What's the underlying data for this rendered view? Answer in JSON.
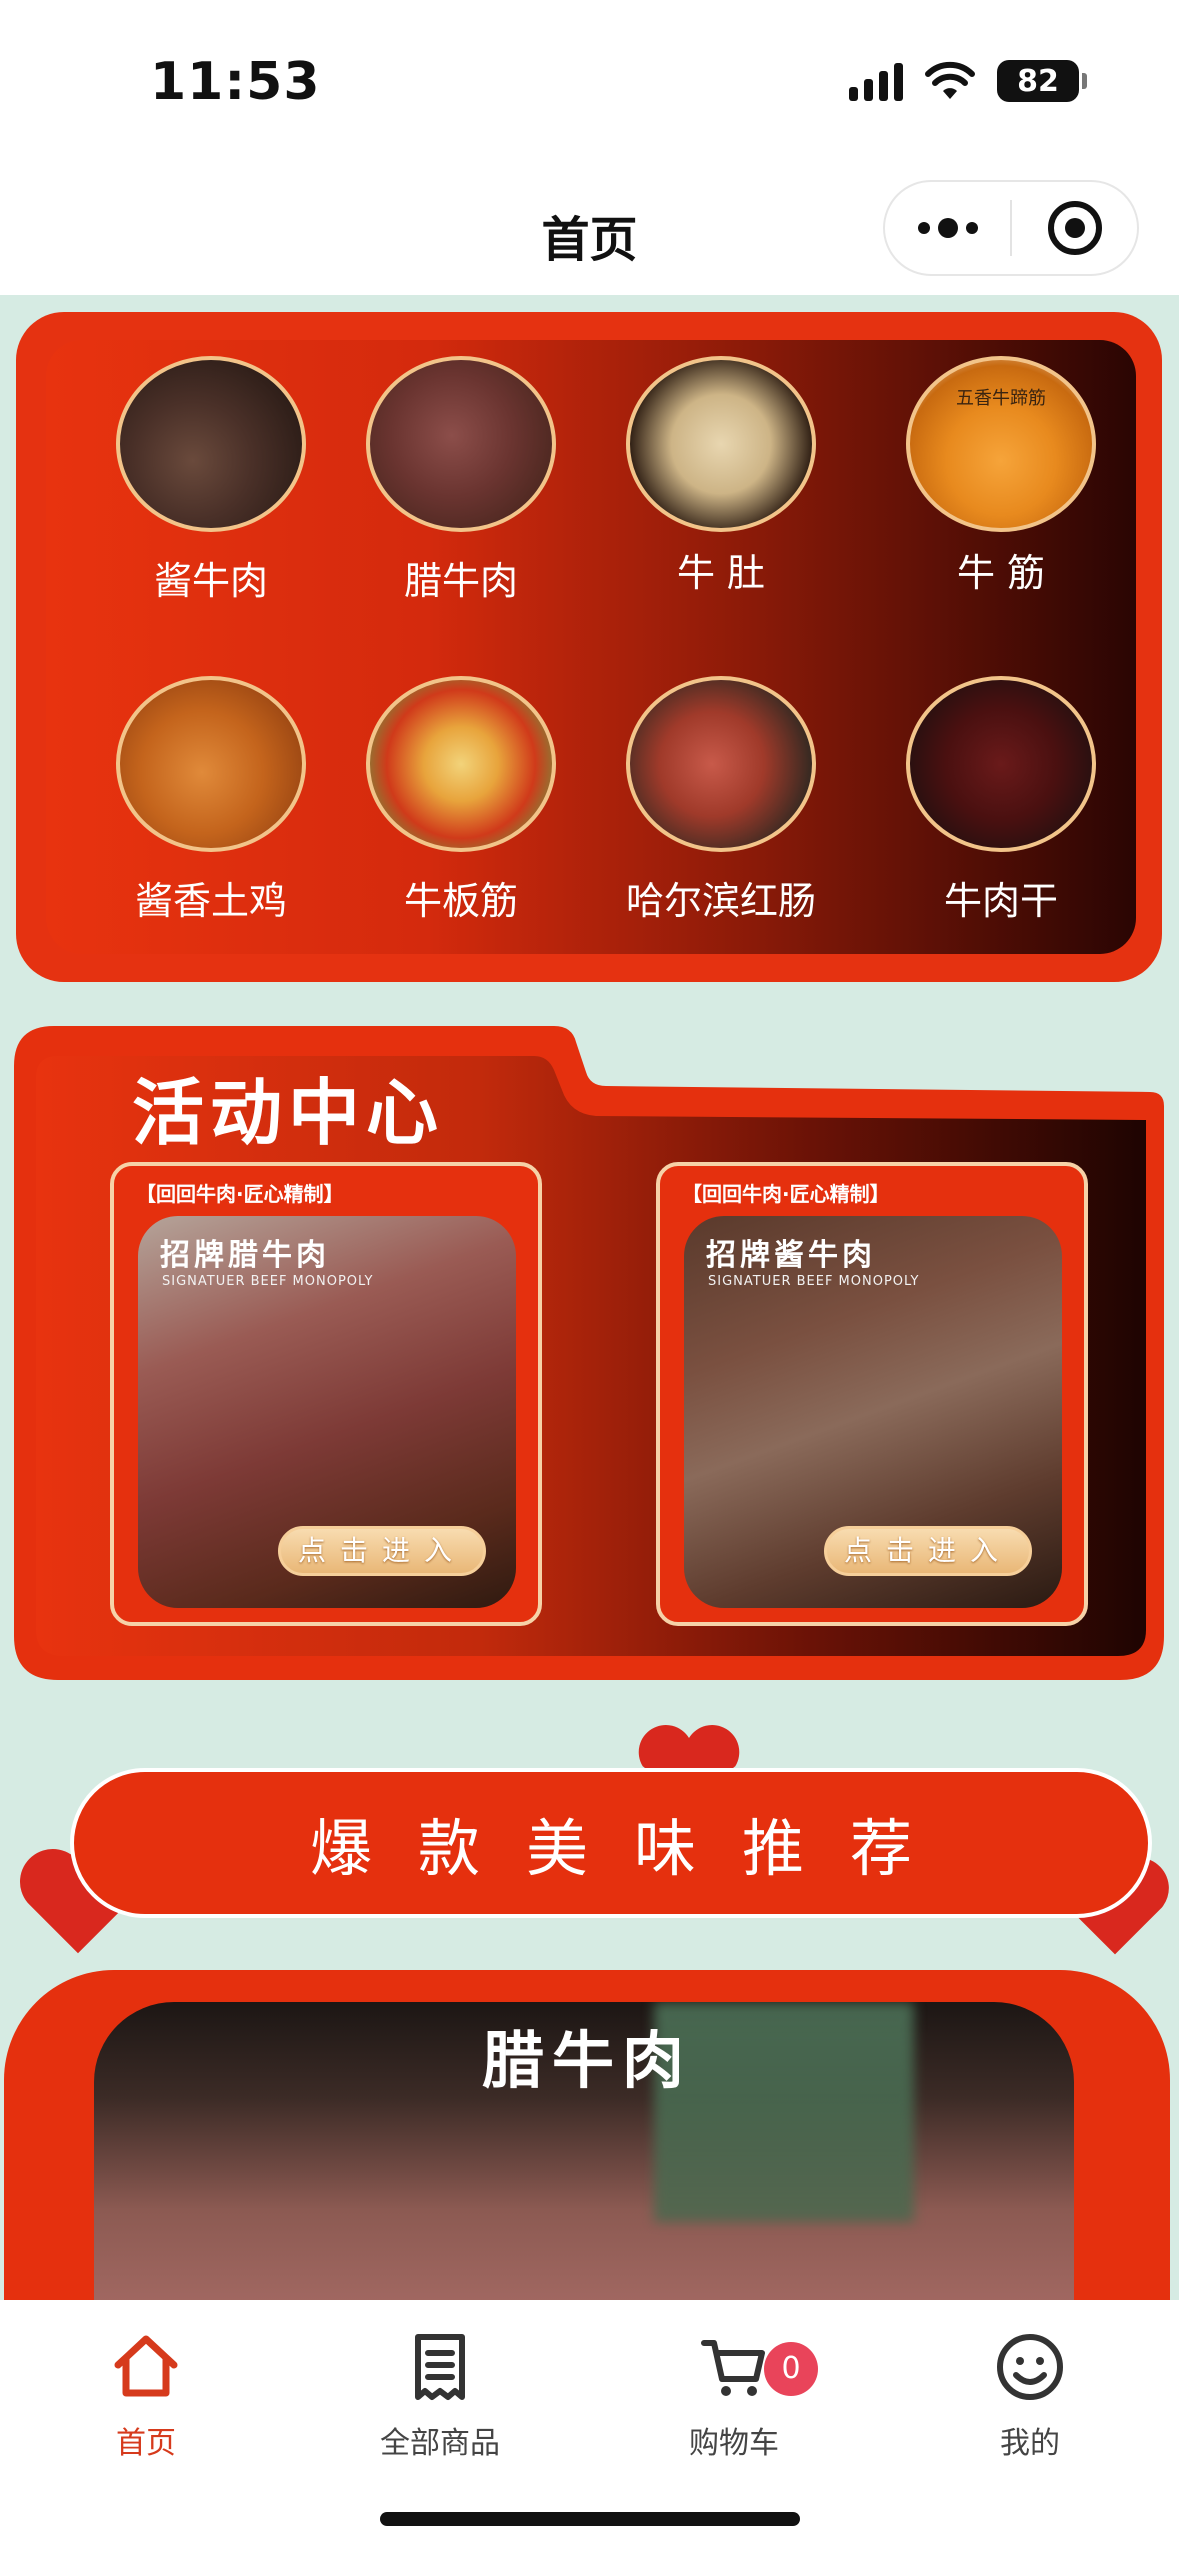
{
  "status_bar": {
    "time": "11:53",
    "battery": "82"
  },
  "nav": {
    "title": "首页"
  },
  "categories": [
    {
      "label": "酱牛肉"
    },
    {
      "label": "腊牛肉"
    },
    {
      "label": "牛 肚"
    },
    {
      "label": "牛 筋"
    },
    {
      "label": "酱香土鸡"
    },
    {
      "label": "牛板筋"
    },
    {
      "label": "哈尔滨红肠"
    },
    {
      "label": "牛肉干"
    }
  ],
  "category_4_seal": "五香牛蹄筋",
  "activity": {
    "title": "活动中心",
    "cards": [
      {
        "header": "【回回牛肉·匠心精制】",
        "name": "招牌腊牛肉",
        "subtitle": "SIGNATUER BEEF MONOPOLY",
        "button": "点击进入"
      },
      {
        "header": "【回回牛肉·匠心精制】",
        "name": "招牌酱牛肉",
        "subtitle": "SIGNATUER BEEF MONOPOLY",
        "button": "点击进入"
      }
    ]
  },
  "recommend": {
    "title": "爆款美味推荐"
  },
  "product": {
    "title": "腊牛肉"
  },
  "tabs": [
    {
      "label": "首页",
      "icon": "home-icon",
      "active": true
    },
    {
      "label": "全部商品",
      "icon": "receipt-icon",
      "active": false
    },
    {
      "label": "购物车",
      "icon": "cart-icon",
      "active": false,
      "badge": "0"
    },
    {
      "label": "我的",
      "icon": "smiley-icon",
      "active": false
    }
  ],
  "colors": {
    "primary_red": "#e5300e",
    "background": "#d6ebe3",
    "tab_active": "#d63a1c",
    "badge": "#e9445a"
  }
}
